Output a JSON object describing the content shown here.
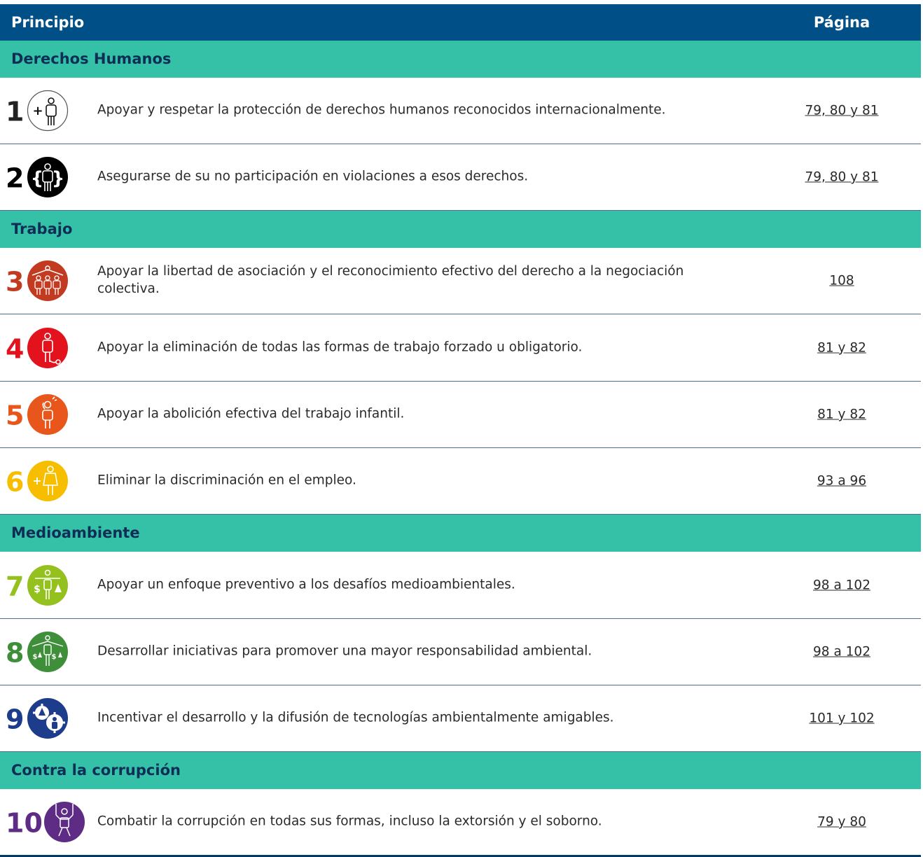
{
  "header": {
    "principle_label": "Principio",
    "page_label": "Página"
  },
  "sections": [
    {
      "title": "Derechos Humanos"
    },
    {
      "title": "Trabajo"
    },
    {
      "title": "Medioambiente"
    },
    {
      "title": "Contra la corrupción"
    }
  ],
  "principles": [
    {
      "number": "1",
      "text": "Apoyar y respetar la protección de derechos humanos reconocidos internacionalmente.",
      "pages": "79, 80 y 81",
      "color": "#222222",
      "icon": "person-plus-outline-icon"
    },
    {
      "number": "2",
      "text": "Asegurarse de su no participación en violaciones a esos derechos.",
      "pages": "79, 80 y 81",
      "color": "#000000",
      "icon": "person-braces-icon"
    },
    {
      "number": "3",
      "text": "Apoyar la libertad de asociación y el reconocimiento efectivo del derecho a la negociación colectiva.",
      "pages": "108",
      "color": "#c23b21",
      "icon": "group-association-icon"
    },
    {
      "number": "4",
      "text": "Apoyar la eliminación de todas las formas de trabajo forzado u obligatorio.",
      "pages": "81 y 82",
      "color": "#e3131d",
      "icon": "person-ball-chain-icon"
    },
    {
      "number": "5",
      "text": "Apoyar la abolición efectiva del trabajo infantil.",
      "pages": "81 y 82",
      "color": "#e8561b",
      "icon": "child-labor-icon"
    },
    {
      "number": "6",
      "text": "Eliminar la discriminación en el empleo.",
      "pages": "93 a 96",
      "color": "#f7be00",
      "icon": "person-plus-woman-icon"
    },
    {
      "number": "7",
      "text": "Apoyar un enfoque preventivo a los desafíos medioambientales.",
      "pages": "98 a 102",
      "color": "#95c11f",
      "icon": "person-balance-tree-icon"
    },
    {
      "number": "8",
      "text": "Desarrollar iniciativas para promover una mayor responsabilidad ambiental.",
      "pages": "98 a 102",
      "color": "#3f8f3a",
      "icon": "group-balance-tree-icon"
    },
    {
      "number": "9",
      "text": "Incentivar el desarrollo y la difusión de tecnologías ambientalmente amigables.",
      "pages": "101 y 102",
      "color": "#1e3c8c",
      "icon": "gears-tree-icon"
    },
    {
      "number": "10",
      "text": "Combatir la corrupción en todas sus formas, incluso la extorsión y el soborno.",
      "pages": "79 y 80",
      "color": "#5e2c84",
      "icon": "puppet-person-icon"
    }
  ]
}
